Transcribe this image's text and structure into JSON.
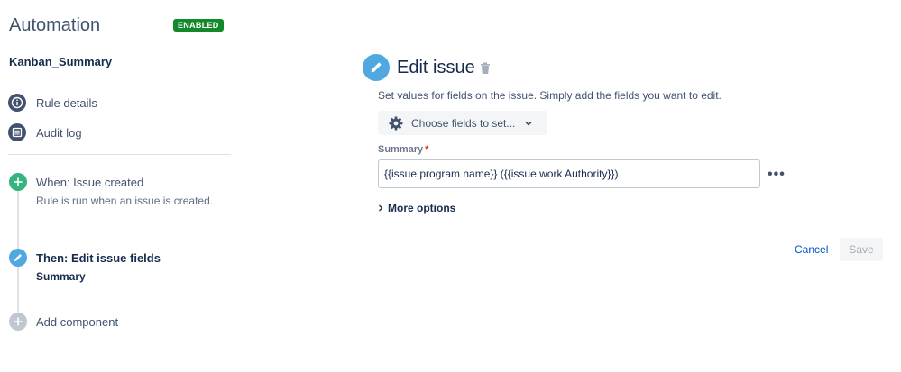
{
  "sidebar": {
    "app_title": "Automation",
    "status_badge": "ENABLED",
    "rule_name": "Kanban_Summary",
    "nav": [
      {
        "label": "Rule details",
        "icon": "info-icon"
      },
      {
        "label": "Audit log",
        "icon": "list-icon"
      }
    ],
    "steps": {
      "trigger": {
        "title": "When: Issue created",
        "subtitle": "Rule is run when an issue is created.",
        "icon": "plus-icon",
        "color": "#36b37e"
      },
      "action": {
        "title": "Then: Edit issue fields",
        "subtitle": "Summary",
        "icon": "pencil-icon",
        "color": "#4fa8e0"
      },
      "add": {
        "title": "Add component",
        "icon": "plus-icon",
        "color": "#c1c7d0"
      }
    }
  },
  "panel": {
    "title": "Edit issue",
    "description": "Set values for fields on the issue. Simply add the fields you want to edit.",
    "choose_fields_label": "Choose fields to set...",
    "field_label": "Summary",
    "required_marker": "*",
    "summary_value": "{{issue.program name}} ({{issue.work Authority}})",
    "more_icon": "more-dots-icon",
    "more_options_label": "More options",
    "cancel_label": "Cancel",
    "save_label": "Save"
  },
  "colors": {
    "accent": "#4fa8e0",
    "enabled_badge": "#14892c",
    "link": "#0052cc",
    "required": "#de350b"
  }
}
